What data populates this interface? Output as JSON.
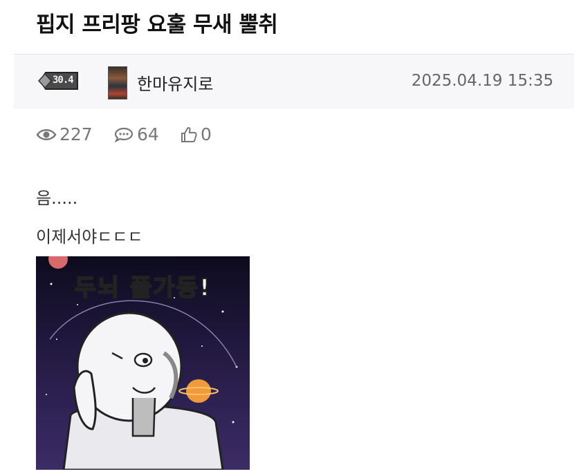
{
  "post": {
    "title": "핍지 프리팡 요훌 무새 뿔취",
    "author": {
      "level": "30.4",
      "name": "한마유지로"
    },
    "date": "2025.04.19 15:35",
    "stats": {
      "views": "227",
      "comments": "64",
      "likes": "0"
    },
    "body": {
      "lines": [
        "음.....",
        "이제서야ㄷㄷㄷ"
      ],
      "image_caption": "두뇌 풀가동!"
    }
  },
  "icons": {
    "views": "eye-icon",
    "comments": "comment-icon",
    "likes": "thumbs-up-icon"
  },
  "colors": {
    "title": "#111111",
    "meta_bg": "#f7f7f9",
    "stat": "#777777"
  }
}
